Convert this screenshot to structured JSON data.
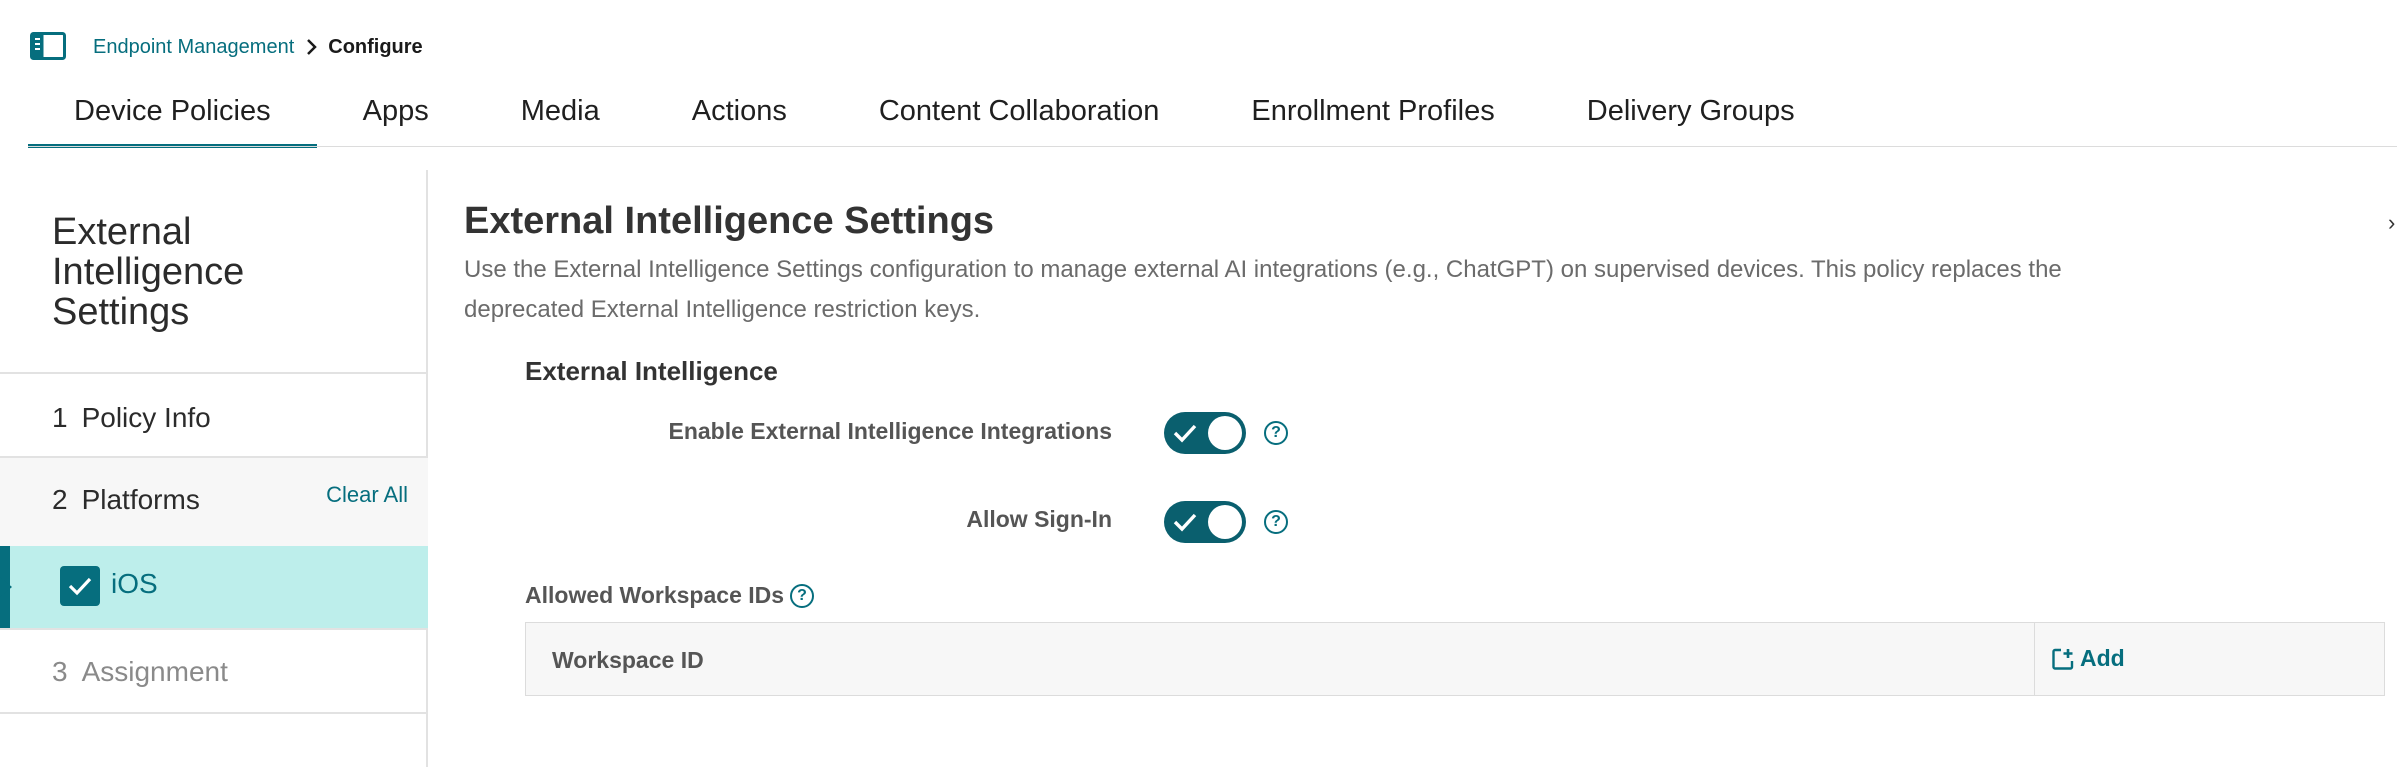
{
  "breadcrumb": {
    "parent": "Endpoint Management",
    "current": "Configure"
  },
  "tabs": [
    {
      "label": "Device Policies",
      "active": true
    },
    {
      "label": "Apps"
    },
    {
      "label": "Media"
    },
    {
      "label": "Actions"
    },
    {
      "label": "Content Collaboration"
    },
    {
      "label": "Enrollment Profiles"
    },
    {
      "label": "Delivery Groups"
    }
  ],
  "sidebar": {
    "title_line1": "External",
    "title_line2": "Intelligence",
    "title_line3": "Settings",
    "steps": [
      {
        "num": "1",
        "label": "Policy Info"
      },
      {
        "num": "2",
        "label": "Platforms",
        "action": "Clear All"
      },
      {
        "num": "3",
        "label": "Assignment"
      }
    ],
    "platform": {
      "label": "iOS",
      "checked": true
    }
  },
  "main": {
    "title": "External Intelligence Settings",
    "description": "Use the External Intelligence Settings configuration to manage external AI integrations (e.g., ChatGPT) on supervised devices. This policy replaces the deprecated External Intelligence restriction keys.",
    "section_title": "External Intelligence",
    "settings": [
      {
        "label": "Enable External Intelligence Integrations",
        "enabled": true
      },
      {
        "label": "Allow Sign-In",
        "enabled": true
      }
    ],
    "allowed_label": "Allowed Workspace IDs",
    "table": {
      "column": "Workspace ID",
      "add_label": "Add"
    }
  },
  "help_glyph": "?",
  "edge_glyph": "›",
  "colors": {
    "accent": "#066e7e",
    "selected_row": "#bdeeeb",
    "toggle_on": "#0a5f6e"
  }
}
